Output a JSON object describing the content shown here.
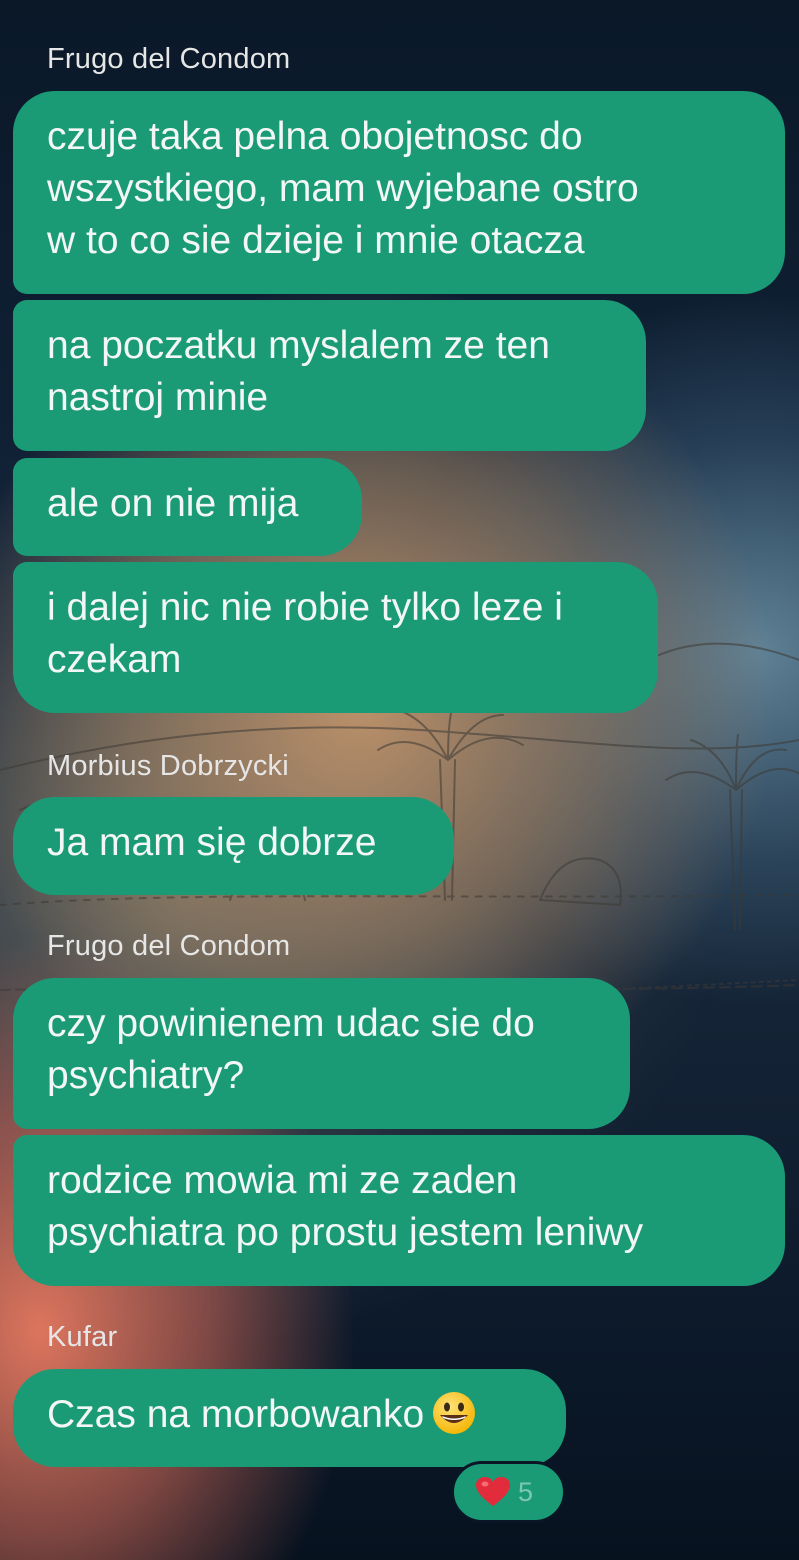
{
  "colors": {
    "bubble": "#1a9b76",
    "bubble_text": "#f2f6f4",
    "sender_text": "#e6e6e6",
    "reaction_count": "#7dc8b0"
  },
  "messages": [
    {
      "sender": "Frugo del Condom",
      "bubbles": [
        [
          "czuje taka pelna obojetnosc do",
          "wszystkiego, mam wyjebane ostro",
          "w to co sie dzieje i mnie otacza"
        ],
        [
          "na poczatku myslalem ze ten",
          "nastroj minie"
        ],
        [
          "ale on nie mija"
        ],
        [
          "i dalej nic nie robie tylko leze i",
          "czekam"
        ]
      ]
    },
    {
      "sender": "Morbius Dobrzycki",
      "bubbles": [
        [
          "Ja mam się dobrze"
        ]
      ]
    },
    {
      "sender": "Frugo del Condom",
      "bubbles": [
        [
          "czy powinienem udac sie do",
          "psychiatry?"
        ],
        [
          "rodzice mowia mi ze zaden",
          "psychiatra po prostu jestem leniwy"
        ]
      ]
    },
    {
      "sender": "Kufar",
      "bubbles": [
        [
          "Czas na morbowanko"
        ]
      ],
      "emoji": "grinning-face-emoji",
      "reaction": {
        "icon": "heart-icon",
        "count": "5"
      }
    }
  ]
}
